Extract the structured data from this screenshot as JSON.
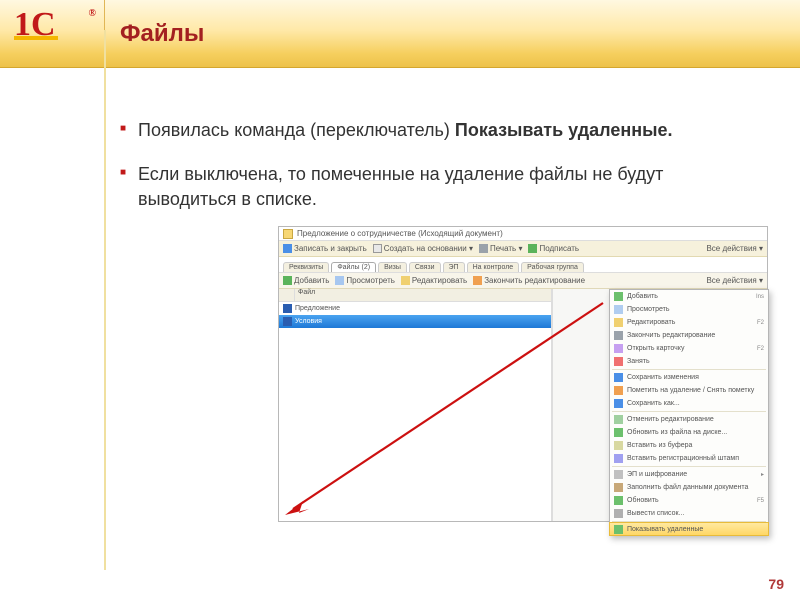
{
  "header": {
    "title": "Файлы"
  },
  "logo": {
    "text": "1С",
    "reg": "®"
  },
  "bullets": [
    {
      "pre": "Появилась команда (переключатель) ",
      "bold": "Показывать удаленные."
    },
    {
      "pre": "Если выключена, то помеченные на удаление файлы не будут выводиться в списке.",
      "bold": ""
    }
  ],
  "page_number": "79",
  "screenshot": {
    "window_title": "Предложение о сотрудничестве (Исходящий документ)",
    "toolbar1": {
      "save_close": "Записать и закрыть",
      "create_from": "Создать на основании",
      "print": "Печать",
      "sign": "Подписать",
      "all_actions": "Все действия"
    },
    "tabs": [
      "Реквизиты",
      "Файлы (2)",
      "Визы",
      "Связи",
      "ЭП",
      "На контроле",
      "Рабочая группа"
    ],
    "toolbar2": {
      "add": "Добавить",
      "view": "Просмотреть",
      "edit": "Редактировать",
      "done": "Закончить редактирование",
      "all_actions": "Все действия"
    },
    "filelist": {
      "header": "Файл",
      "rows": [
        {
          "name": "Предложение",
          "icon": "word",
          "selected": false
        },
        {
          "name": "Условия",
          "icon": "word",
          "selected": true
        }
      ]
    },
    "context_menu": [
      {
        "label": "Добавить",
        "key": "Ins",
        "icon": "ci-add"
      },
      {
        "label": "Просмотреть",
        "key": "",
        "icon": "ci-view"
      },
      {
        "label": "Редактировать",
        "key": "F2",
        "icon": "ci-edit"
      },
      {
        "label": "Закончить редактирование",
        "key": "",
        "icon": "ci-lock"
      },
      {
        "label": "Открыть карточку",
        "key": "F2",
        "icon": "ci-pic"
      },
      {
        "label": "Занять",
        "key": "",
        "icon": "ci-del"
      },
      {
        "sep": true
      },
      {
        "label": "Сохранить изменения",
        "key": "",
        "icon": "ci-save"
      },
      {
        "label": "Пометить на удаление / Снять пометку",
        "key": "",
        "icon": "ci-mark"
      },
      {
        "label": "Сохранить как...",
        "key": "",
        "icon": "ci-save"
      },
      {
        "sep": true
      },
      {
        "label": "Отменить редактирование",
        "key": "",
        "icon": "ci-undo"
      },
      {
        "label": "Обновить из файла на диске...",
        "key": "",
        "icon": "ci-refresh"
      },
      {
        "label": "Вставить из буфера",
        "key": "",
        "icon": "ci-paste"
      },
      {
        "label": "Вставить регистрационный штамп",
        "key": "",
        "icon": "ci-reg"
      },
      {
        "sep": true
      },
      {
        "label": "ЭП и шифрование",
        "key": "",
        "icon": "ci-enc",
        "submenu": true
      },
      {
        "label": "Заполнить файл данными документа",
        "key": "",
        "icon": "ci-archive"
      },
      {
        "label": "Обновить",
        "key": "F5",
        "icon": "ci-refresh"
      },
      {
        "label": "Вывести список...",
        "key": "",
        "icon": "ci-list"
      },
      {
        "sep": true
      },
      {
        "label": "Показывать удаленные",
        "key": "",
        "icon": "ci-show",
        "highlight": true
      }
    ]
  }
}
